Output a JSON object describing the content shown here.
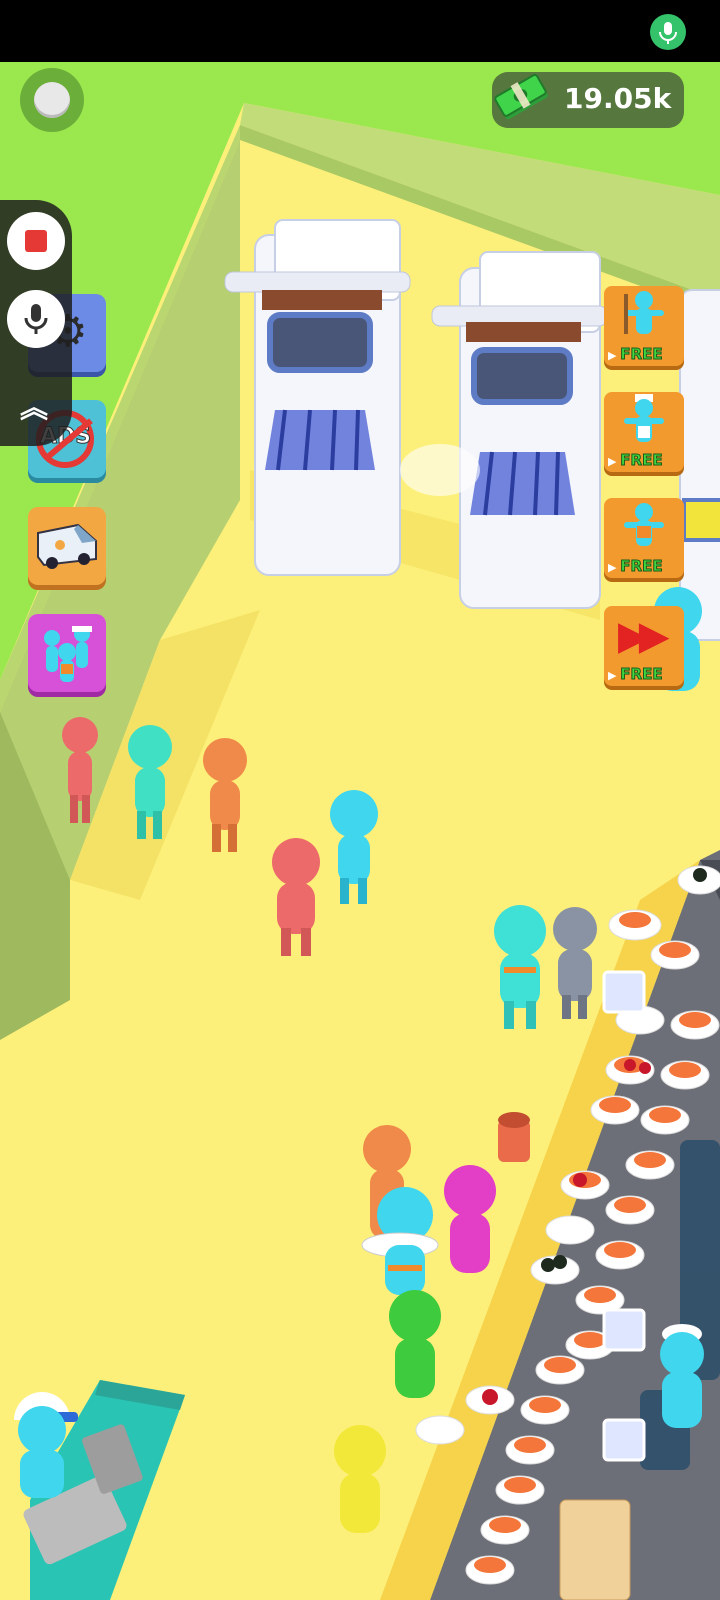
{
  "hud": {
    "cash_amount": "19.05k"
  },
  "side_buttons": [
    {
      "name": "settings",
      "icon": "gear-icon"
    },
    {
      "name": "no-ads",
      "icon": "no-ads-icon",
      "label": "ADS"
    },
    {
      "name": "delivery",
      "icon": "van-icon"
    },
    {
      "name": "staff",
      "icon": "staff-icon"
    }
  ],
  "offer_buttons": [
    {
      "name": "upgrade-free-1",
      "label": "FREE"
    },
    {
      "name": "upgrade-free-2",
      "label": "FREE"
    },
    {
      "name": "upgrade-free-3",
      "label": "FREE"
    },
    {
      "name": "speed-free",
      "label": "FREE"
    }
  ],
  "screen_recorder": {
    "buttons": [
      "record-stop",
      "record-mic"
    ]
  },
  "colors": {
    "floor": "#fdf07a",
    "wall": "#c9e08a",
    "grass": "#9be84e",
    "cash_green": "#3fd63f",
    "offer_orange": "#f39a2e"
  }
}
